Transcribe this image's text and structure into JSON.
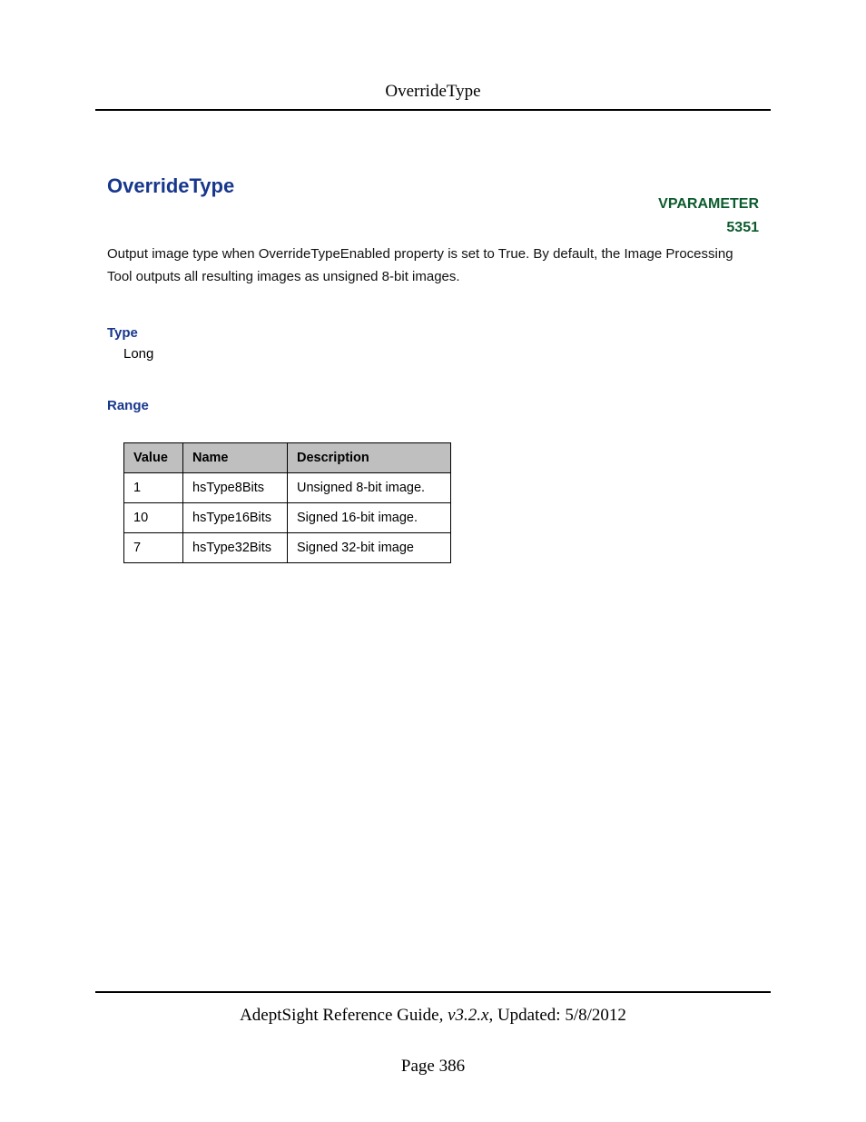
{
  "header": {
    "running_title": "OverrideType"
  },
  "topic": {
    "title": "OverrideType",
    "vparam_label": "VPARAMETER",
    "vparam_id": "5351",
    "description": "Output image type when OverrideTypeEnabled property is set to True. By default, the Image Processing Tool outputs all resulting images as unsigned 8-bit images."
  },
  "type_section": {
    "label": "Type",
    "value": "Long"
  },
  "range_section": {
    "label": "Range",
    "columns": {
      "value": "Value",
      "name": "Name",
      "description": "Description"
    },
    "rows": [
      {
        "value": "1",
        "name": "hsType8Bits",
        "description": "Unsigned 8-bit image."
      },
      {
        "value": "10",
        "name": "hsType16Bits",
        "description": "Signed 16-bit image."
      },
      {
        "value": "7",
        "name": "hsType32Bits",
        "description": "Signed 32-bit image"
      }
    ]
  },
  "footer": {
    "product": "AdeptSight Reference Guide",
    "version": ", v3.2.x",
    "updated_prefix": ", Updated: ",
    "updated_date": "5/8/2012",
    "page_label": "Page ",
    "page_number": "386"
  }
}
